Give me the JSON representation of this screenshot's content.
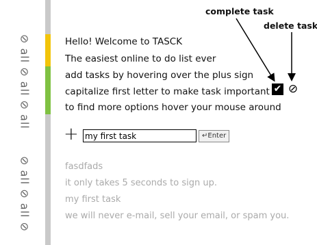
{
  "sidebar": {
    "top_tab": {
      "label": "⊘ all ⊘ all ⊘ all"
    },
    "bottom_tab": {
      "label": "⊘ all ⊘ all ⊘"
    },
    "stripe_colors": [
      "#f2c40a",
      "#7fc142"
    ]
  },
  "annotations": {
    "complete_task": "complete task",
    "delete_task": "delete task"
  },
  "intro_lines": [
    "Hello! Welcome to TASCK",
    "The easiest online to do list ever",
    "add tasks by hovering over the plus sign",
    "capitalize first letter to make task important",
    "to find more options hover your mouse around"
  ],
  "task_actions": {
    "complete_icon": "check-icon",
    "complete_glyph": "✔",
    "delete_icon": "prohibited-icon",
    "delete_glyph": "⊘"
  },
  "add_task": {
    "plus_glyph": "+",
    "input_value": "my first task",
    "enter_label": "↵Enter"
  },
  "completed_items": [
    "fasdfads",
    "it only takes 5 seconds to sign up.",
    "my first task",
    "we will never e-mail, sell your email, or spam you."
  ]
}
